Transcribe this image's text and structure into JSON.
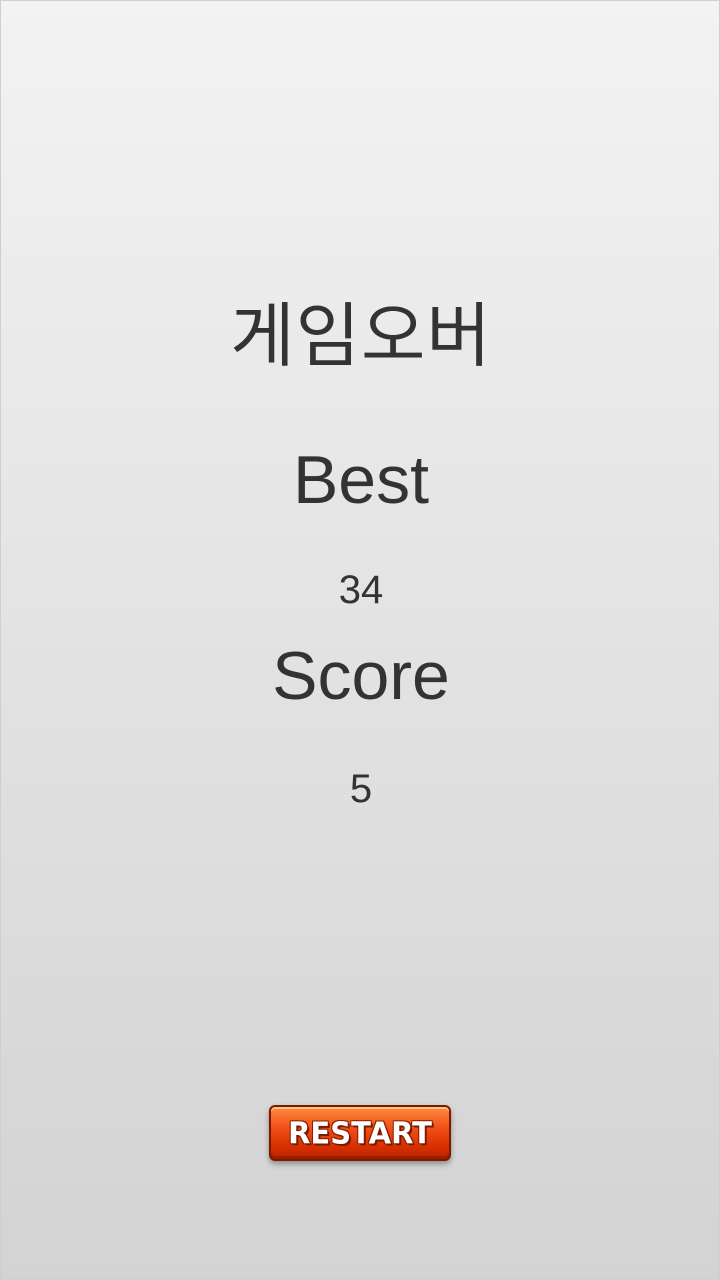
{
  "screen": {
    "title": "게임오버",
    "best_label": "Best",
    "best_value": "34",
    "score_label": "Score",
    "score_value": "5"
  },
  "restart_button": {
    "label": "RESTART"
  },
  "colors": {
    "text": "#333333",
    "button": "#e04010",
    "background_top": "#f3f3f3",
    "background_bottom": "#d3d3d3"
  }
}
